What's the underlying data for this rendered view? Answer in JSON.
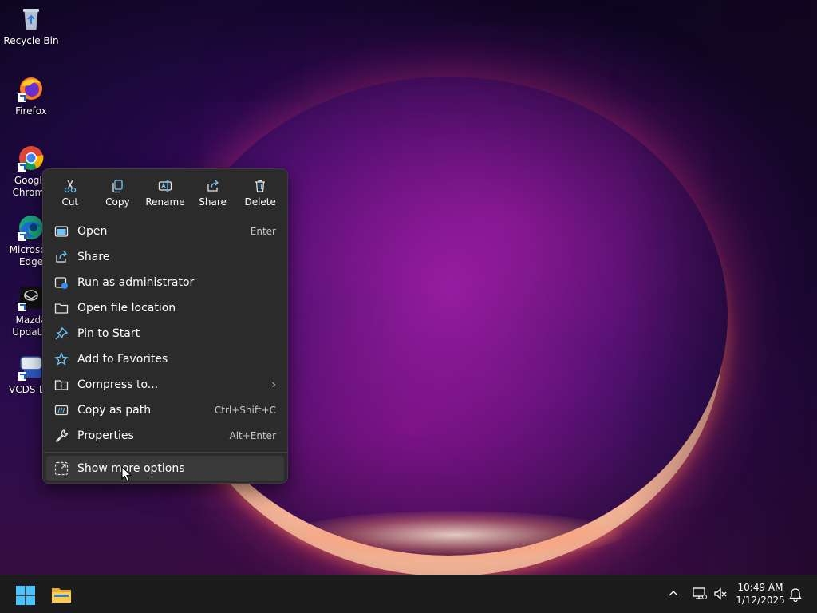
{
  "desktop": {
    "icons": [
      {
        "label": "Recycle Bin",
        "icon": "recycle-bin-icon"
      },
      {
        "label": "Firefox",
        "icon": "firefox-icon"
      },
      {
        "label": "Google Chrome",
        "icon": "chrome-icon"
      },
      {
        "label": "Microsoft Edge",
        "icon": "edge-icon"
      },
      {
        "label": "Mazda Updat...",
        "icon": "mazda-icon"
      },
      {
        "label": "VCDS-L...",
        "icon": "vcds-icon"
      }
    ]
  },
  "context_menu": {
    "quick_actions": [
      {
        "label": "Cut",
        "icon": "scissors-icon"
      },
      {
        "label": "Copy",
        "icon": "copy-icon"
      },
      {
        "label": "Rename",
        "icon": "rename-icon"
      },
      {
        "label": "Share",
        "icon": "share-icon"
      },
      {
        "label": "Delete",
        "icon": "trash-icon"
      }
    ],
    "items": [
      {
        "label": "Open",
        "accel": "Enter",
        "icon": "open-window-icon"
      },
      {
        "label": "Share",
        "accel": "",
        "icon": "share-icon"
      },
      {
        "label": "Run as administrator",
        "accel": "",
        "icon": "shield-window-icon"
      },
      {
        "label": "Open file location",
        "accel": "",
        "icon": "folder-icon"
      },
      {
        "label": "Pin to Start",
        "accel": "",
        "icon": "pin-icon"
      },
      {
        "label": "Add to Favorites",
        "accel": "",
        "icon": "star-icon"
      },
      {
        "label": "Compress to...",
        "accel": "",
        "icon": "zip-folder-icon",
        "submenu": true
      },
      {
        "label": "Copy as path",
        "accel": "Ctrl+Shift+C",
        "icon": "path-icon"
      },
      {
        "label": "Properties",
        "accel": "Alt+Enter",
        "icon": "wrench-icon"
      }
    ],
    "more_options": {
      "label": "Show more options",
      "icon": "more-options-icon"
    }
  },
  "taskbar": {
    "time": "10:49 AM",
    "date": "1/12/2025",
    "icons": [
      "start-icon",
      "file-explorer-icon",
      "chevron-up-icon",
      "network-icon",
      "volume-muted-icon",
      "notification-icon"
    ]
  },
  "colors": {
    "menu_bg": "#2b2b2b",
    "taskbar_bg": "#1c1c1c",
    "accent": "#60cdff"
  }
}
